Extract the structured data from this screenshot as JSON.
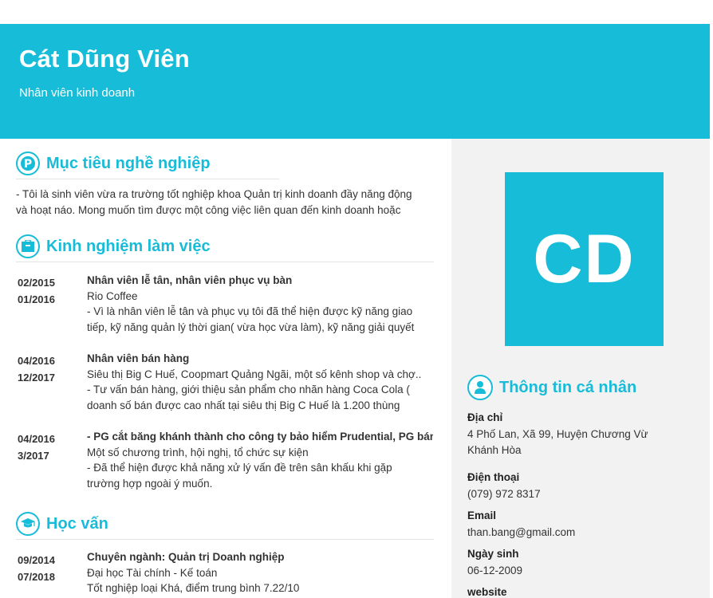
{
  "header": {
    "name": "Cát Dũng Viên",
    "job_title": "Nhân viên kinh doanh"
  },
  "sections": {
    "objective": {
      "title": "Mục tiêu nghề nghiệp",
      "text_lines": [
        "- Tôi là sinh viên vừa ra trường tốt nghiệp khoa Quản trị kinh doanh đầy năng động",
        "và hoạt náo. Mong muốn tìm được một công việc liên quan đến kinh doanh hoặc"
      ]
    },
    "experience": {
      "title": "Kinh nghiệm làm việc",
      "items": [
        {
          "start": "02/2015",
          "end": "01/2016",
          "position": "Nhân viên lễ tân, nhân viên phục vụ bàn",
          "company": "Rio Coffee",
          "lines": [
            " - Vì là nhân viên lễ tân và phục vụ tôi đã thể hiện được kỹ năng giao",
            "tiếp, kỹ năng quản lý thời gian( vừa học vừa làm), kỹ năng giải quyết"
          ]
        },
        {
          "start": "04/2016",
          "end": "12/2017",
          "position": "Nhân viên bán hàng",
          "company": "Siêu thị Big C Huế, Coopmart Quảng Ngãi, một số kênh shop và chợ..",
          "lines": [
            " - Tư vấn bán hàng, giới thiệu sản phẩm cho nhãn hàng Coca Cola (",
            "doanh số bán được cao nhất tại siêu thị Big C Huế là 1.200 thùng"
          ]
        },
        {
          "start": "04/2016",
          "end": "3/2017",
          "position": " - PG cắt băng khánh thành cho công ty bảo hiểm Prudential, PG bán",
          "company": "Một số chương trình, hội nghị, tổ chức sự kiện",
          "lines": [
            " - Đã thể hiện được khả năng xử lý vấn đề trên sân khấu khi gặp",
            "trường hợp ngoài ý muốn."
          ]
        }
      ]
    },
    "education": {
      "title": "Học vấn",
      "items": [
        {
          "start": "09/2014",
          "end": "07/2018",
          "major": "Chuyên ngành: Quản trị Doanh nghiệp",
          "school": "Đại học Tài chính - Kế toán",
          "lines": [
            "Tốt nghiệp loại Khá, điểm trung bình 7.22/10"
          ]
        }
      ]
    }
  },
  "sidebar": {
    "avatar_initials": "CD",
    "personal_info_title": "Thông tin cá nhân",
    "address_label": "Địa chỉ",
    "address_lines": [
      "4 Phố Lan, Xã 99, Huyện Chương Vừ",
      "Khánh Hòa"
    ],
    "phone_label": "Điện thoại",
    "phone": "(079) 972 8317",
    "email_label": "Email",
    "email": "than.bang@gmail.com",
    "birthday_label": "Ngày sinh",
    "birthday": "06-12-2009",
    "website_label": "website"
  },
  "colors": {
    "accent": "#17bcd9",
    "sidebar_bg": "#f2f2f2"
  },
  "icons": {
    "objective": "pinterest-icon",
    "experience": "briefcase-icon",
    "education": "graduation-cap-icon",
    "personal_info": "user-icon"
  }
}
